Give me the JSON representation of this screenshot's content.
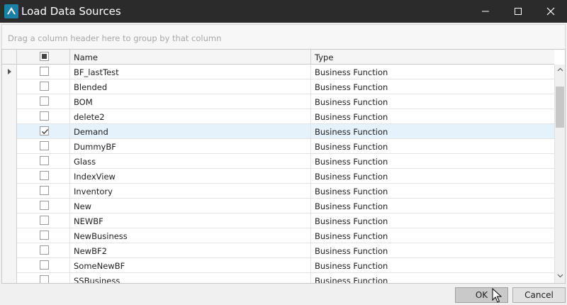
{
  "window": {
    "title": "Load Data Sources",
    "icon": "app-logo-icon",
    "controls": [
      "minimize-icon",
      "maximize-icon",
      "close-icon"
    ]
  },
  "group_panel": {
    "text": "Drag a column header here to group by that column"
  },
  "grid": {
    "columns": [
      {
        "key": "check",
        "label": ""
      },
      {
        "key": "name",
        "label": "Name"
      },
      {
        "key": "type",
        "label": "Type"
      }
    ],
    "header_checkbox_state": "indeterminate",
    "rows": [
      {
        "name": "BF_lastTest",
        "type": "Business Function",
        "checked": false,
        "current": true
      },
      {
        "name": "Blended",
        "type": "Business Function",
        "checked": false
      },
      {
        "name": "BOM",
        "type": "Business Function",
        "checked": false
      },
      {
        "name": "delete2",
        "type": "Business Function",
        "checked": false
      },
      {
        "name": "Demand",
        "type": "Business Function",
        "checked": true,
        "selected": true
      },
      {
        "name": "DummyBF",
        "type": "Business Function",
        "checked": false
      },
      {
        "name": "Glass",
        "type": "Business Function",
        "checked": false
      },
      {
        "name": "IndexView",
        "type": "Business Function",
        "checked": false
      },
      {
        "name": "Inventory",
        "type": "Business Function",
        "checked": false
      },
      {
        "name": "New",
        "type": "Business Function",
        "checked": false
      },
      {
        "name": "NEWBF",
        "type": "Business Function",
        "checked": false
      },
      {
        "name": "NewBusiness",
        "type": "Business Function",
        "checked": false
      },
      {
        "name": "NewBF2",
        "type": "Business Function",
        "checked": false
      },
      {
        "name": "SomeNewBF",
        "type": "Business Function",
        "checked": false
      },
      {
        "name": "SSBusiness",
        "type": "Business Function",
        "checked": false
      }
    ]
  },
  "buttons": {
    "ok_label": "OK",
    "cancel_label": "Cancel"
  },
  "colors": {
    "titlebar": "#2b2b2b",
    "app_icon": "#1b7fa6",
    "selected_row": "#e5f1fb"
  }
}
